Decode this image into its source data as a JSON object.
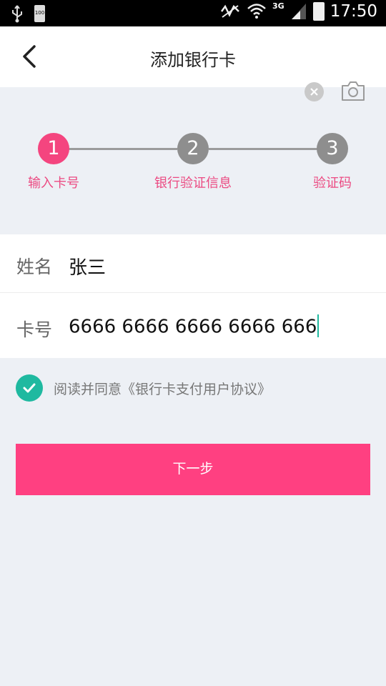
{
  "status_bar": {
    "time": "17:50",
    "network": "3G",
    "battery_text": "100",
    "icons": [
      "usb-icon",
      "battery-icon",
      "nfc-icon",
      "wifi-icon",
      "signal-icon",
      "battery-icon"
    ]
  },
  "header": {
    "title": "添加银行卡",
    "back_icon": "chevron-left-icon"
  },
  "steps": [
    {
      "number": "1",
      "label": "输入卡号",
      "active": true
    },
    {
      "number": "2",
      "label": "银行验证信息",
      "active": false
    },
    {
      "number": "3",
      "label": "验证码",
      "active": false
    }
  ],
  "form": {
    "name_label": "姓名",
    "name_value": "张三",
    "card_label": "卡号",
    "card_value": "6666 6666 6666 6666 666",
    "clear_icon": "clear-icon",
    "camera_icon": "camera-icon"
  },
  "agreement": {
    "checked": true,
    "text": "阅读并同意《银行卡支付用户协议》"
  },
  "next_button": {
    "label": "下一步"
  },
  "colors": {
    "accent_pink": "#ff4081",
    "step_active": "#f4457f",
    "step_inactive": "#8e8e8e",
    "check_green": "#1fb9a0",
    "background": "#edf0f5"
  }
}
